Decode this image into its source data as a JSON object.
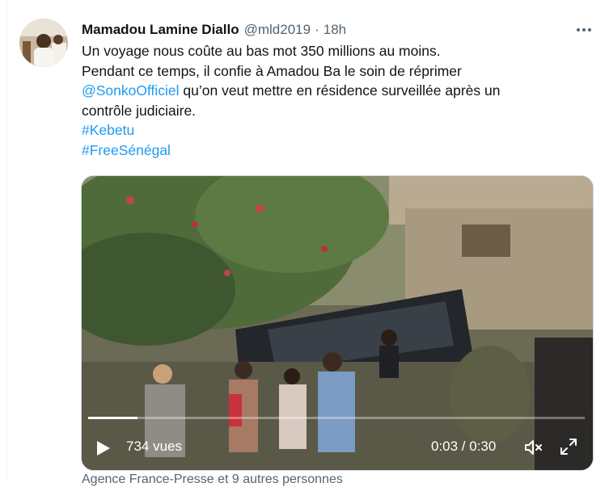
{
  "tweet": {
    "author_name": "Mamadou Lamine Diallo",
    "author_handle": "@mld2019",
    "separator": "·",
    "time": "18h",
    "lines": [
      {
        "text": "Un voyage nous coûte au bas mot 350 millions au moins."
      },
      {
        "text": "Pendant ce temps, il confie à Amadou Ba le soin de réprimer"
      },
      {
        "mention": "@SonkoOfficiel",
        "text": " qu’on veut mettre en résidence surveillée après un"
      },
      {
        "text": "contrôle judiciaire."
      }
    ],
    "hashtags": [
      "#Kebetu",
      "#FreeSénégal"
    ]
  },
  "video": {
    "views": "734 vues",
    "timecode": "0:03 / 0:30",
    "progress": 0.1
  },
  "caption": "Agence France-Presse et 9 autres personnes",
  "icons": {
    "more": "more-dots-icon",
    "play": "play-icon",
    "mute": "speaker-muted-icon",
    "fullscreen": "fullscreen-expand-icon"
  },
  "colors": {
    "link": "#1d9bf0",
    "text": "#0f1419",
    "muted": "#536471"
  }
}
